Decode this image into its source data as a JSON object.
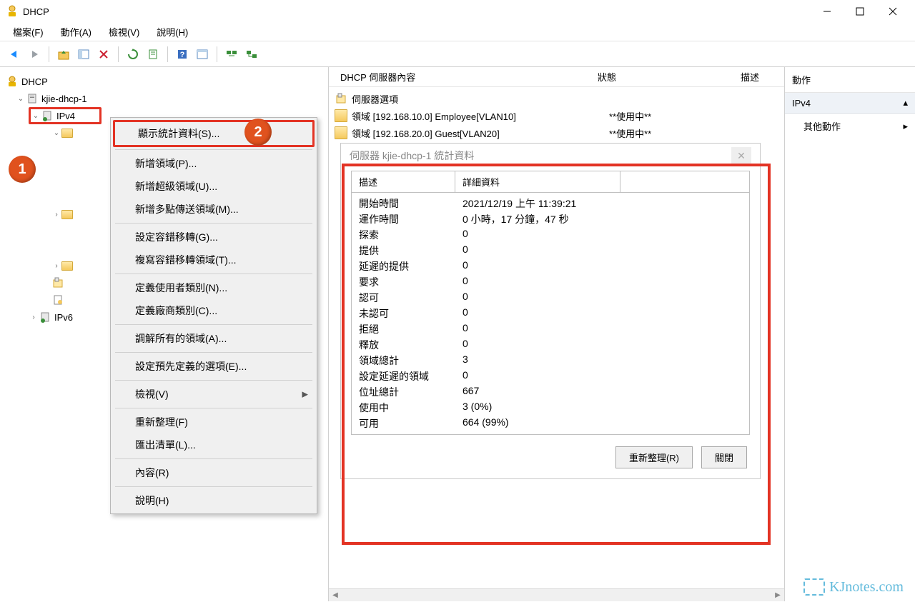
{
  "titlebar": {
    "title": "DHCP"
  },
  "menubar": [
    "檔案(F)",
    "動作(A)",
    "檢視(V)",
    "說明(H)"
  ],
  "tree": {
    "root": "DHCP",
    "server": "kjie-dhcp-1",
    "ipv4": "IPv4",
    "ipv6": "IPv6"
  },
  "context_menu": {
    "show_stats": "顯示統計資料(S)...",
    "new_scope": "新增領域(P)...",
    "new_superscope": "新增超級領域(U)...",
    "new_multicast": "新增多點傳送領域(M)...",
    "failover_config": "設定容錯移轉(G)...",
    "failover_copy": "複寫容錯移轉領域(T)...",
    "user_classes": "定義使用者類別(N)...",
    "vendor_classes": "定義廠商類別(C)...",
    "reconcile": "調解所有的領域(A)...",
    "predefined": "設定預先定義的選項(E)...",
    "view": "檢視(V)",
    "refresh": "重新整理(F)",
    "export": "匯出清單(L)...",
    "properties": "內容(R)",
    "help": "說明(H)"
  },
  "list": {
    "headers": {
      "content": "DHCP 伺服器內容",
      "status": "狀態",
      "desc": "描述"
    },
    "rows": [
      {
        "name": "伺服器選項",
        "status": ""
      },
      {
        "name": "領域 [192.168.10.0] Employee[VLAN10]",
        "status": "**使用中**"
      },
      {
        "name": "領域 [192.168.20.0] Guest[VLAN20]",
        "status": "**使用中**"
      }
    ]
  },
  "dialog": {
    "title": "伺服器 kjie-dhcp-1 統計資料",
    "headers": {
      "desc": "描述",
      "detail": "詳細資料"
    },
    "rows": [
      {
        "k": "開始時間",
        "v": "2021/12/19 上午 11:39:21"
      },
      {
        "k": "運作時間",
        "v": "0 小時，17 分鐘，47 秒"
      },
      {
        "k": "探索",
        "v": "0"
      },
      {
        "k": "提供",
        "v": "0"
      },
      {
        "k": "延遲的提供",
        "v": "0"
      },
      {
        "k": "要求",
        "v": "0"
      },
      {
        "k": "認可",
        "v": "0"
      },
      {
        "k": "未認可",
        "v": "0"
      },
      {
        "k": "拒絕",
        "v": "0"
      },
      {
        "k": "釋放",
        "v": "0"
      },
      {
        "k": "領域總計",
        "v": "3"
      },
      {
        "k": "設定延遲的領域",
        "v": "0"
      },
      {
        "k": "位址總計",
        "v": "667"
      },
      {
        "k": "使用中",
        "v": "3 (0%)"
      },
      {
        "k": "可用",
        "v": "664 (99%)"
      }
    ],
    "buttons": {
      "refresh": "重新整理(R)",
      "close": "關閉"
    }
  },
  "actions": {
    "header": "動作",
    "section": "IPv4",
    "other": "其他動作"
  },
  "watermark": "KJnotes.com"
}
